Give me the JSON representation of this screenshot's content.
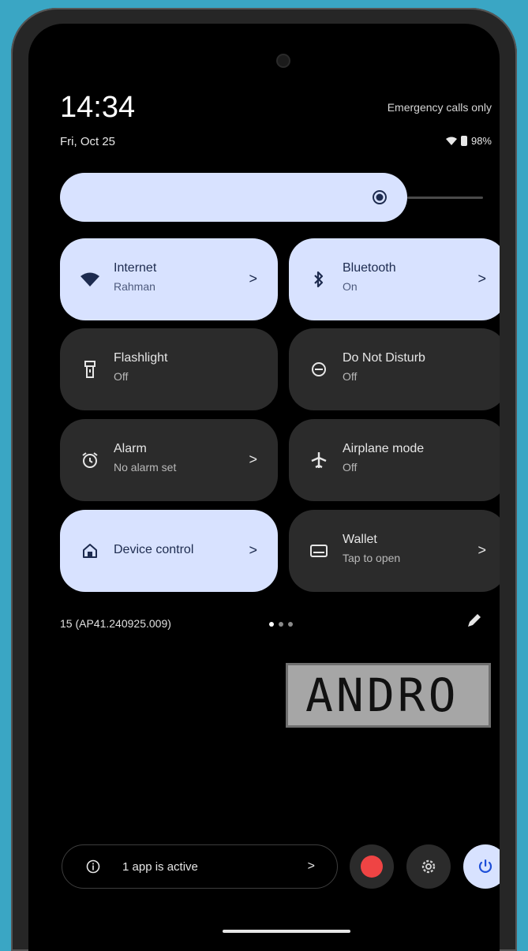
{
  "status": {
    "time": "14:34",
    "date": "Fri, Oct 25",
    "carrier": "Emergency calls only",
    "battery": "98%"
  },
  "brightness": {
    "level": 0.8
  },
  "tiles": [
    {
      "title": "Internet",
      "subtitle": "Rahman",
      "state": "on",
      "icon": "wifi-icon",
      "chevron": ">"
    },
    {
      "title": "Bluetooth",
      "subtitle": "On",
      "state": "on",
      "icon": "bluetooth-icon",
      "chevron": ">"
    },
    {
      "title": "Flashlight",
      "subtitle": "Off",
      "state": "off",
      "icon": "flashlight-icon"
    },
    {
      "title": "Do Not Disturb",
      "subtitle": "Off",
      "state": "off",
      "icon": "do-not-disturb-icon"
    },
    {
      "title": "Alarm",
      "subtitle": "No alarm set",
      "state": "off",
      "icon": "alarm-icon",
      "chevron": ">"
    },
    {
      "title": "Airplane mode",
      "subtitle": "Off",
      "state": "off",
      "icon": "airplane-icon"
    },
    {
      "title": "Device control",
      "state": "on",
      "icon": "home-icon",
      "chevron": ">"
    },
    {
      "title": "Wallet",
      "subtitle": "Tap to open",
      "state": "off",
      "icon": "wallet-icon",
      "chevron": ">"
    }
  ],
  "build": "15 (AP41.240925.009)",
  "pages": {
    "current": 1,
    "total": 3
  },
  "watermark": "ANDRO",
  "footer": {
    "active_apps": "1 app is active",
    "chevron": ">"
  },
  "colors": {
    "tile_on": "#d8e2ff",
    "tile_off": "#2b2b2b",
    "record_red": "#ef4444",
    "background": "#3aa6c4"
  }
}
